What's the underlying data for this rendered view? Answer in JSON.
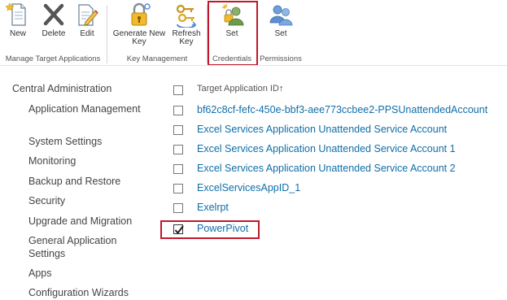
{
  "ribbon": {
    "buttons": {
      "new": "New",
      "delete": "Delete",
      "edit": "Edit",
      "generate_new_key": [
        "Generate New",
        "Key"
      ],
      "refresh_key": [
        "Refresh",
        "Key"
      ],
      "set_credentials": "Set",
      "set_permissions": "Set"
    },
    "groups": {
      "manage": "Manage Target Applications",
      "key": "Key Management",
      "credentials": "Credentials",
      "permissions": "Permissions"
    },
    "icons": {
      "new": "new-document-icon",
      "delete": "delete-x-icon",
      "edit": "edit-document-icon",
      "generate_new_key": "lock-keys-icon",
      "refresh_key": "keys-refresh-icon",
      "set_credentials": "user-credential-icon",
      "set_permissions": "users-permission-icon"
    }
  },
  "nav": {
    "heading": "Central Administration",
    "items": [
      "Application Management",
      "System Settings",
      "Monitoring",
      "Backup and Restore",
      "Security",
      "Upgrade and Migration",
      "General Application Settings",
      "Apps",
      "Configuration Wizards"
    ]
  },
  "list": {
    "header": "Target Application ID",
    "sort_indicator": "↑",
    "rows": [
      {
        "label": "bf62c8cf-fefc-450e-bbf3-aee773ccbee2-PPSUnattendedAccount",
        "checked": false
      },
      {
        "label": "Excel Services Application Unattended Service Account",
        "checked": false
      },
      {
        "label": "Excel Services Application Unattended Service Account 1",
        "checked": false
      },
      {
        "label": "Excel Services Application Unattended Service Account 2",
        "checked": false
      },
      {
        "label": "ExcelServicesAppID_1",
        "checked": false
      },
      {
        "label": "Exelrpt",
        "checked": false
      },
      {
        "label": "PowerPivot",
        "checked": true
      }
    ]
  },
  "colors": {
    "link": "#0f6ea8",
    "highlight": "#c0192b",
    "text": "#444444"
  }
}
